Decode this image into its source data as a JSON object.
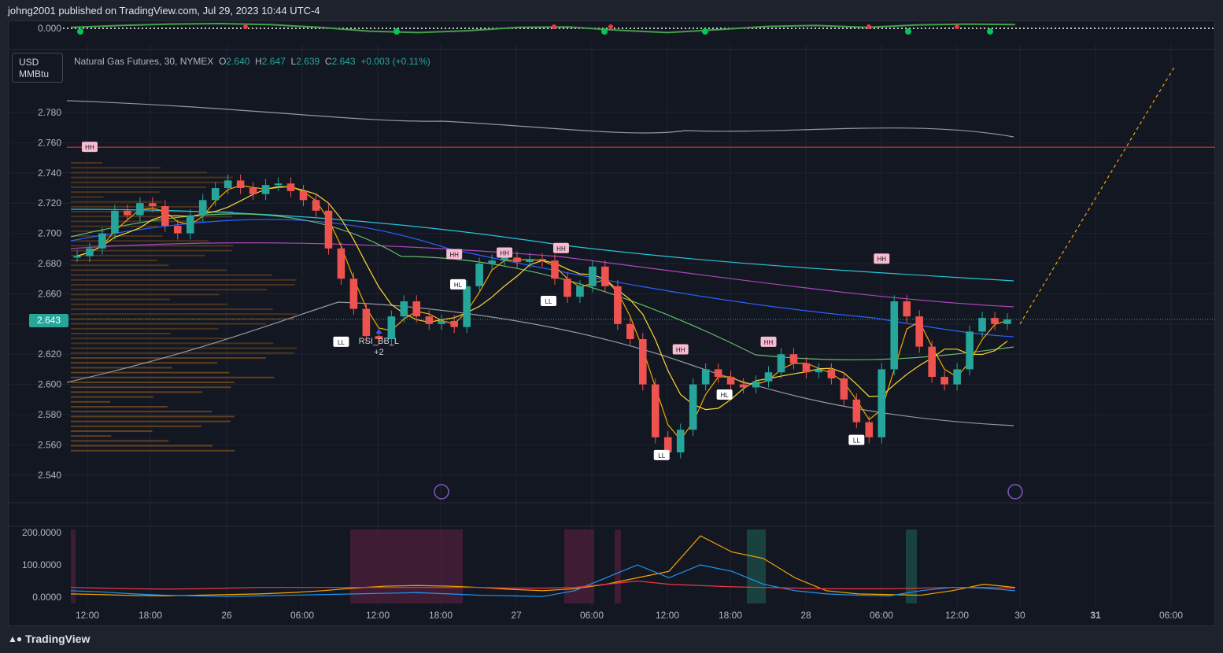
{
  "header": {
    "publish_text": "johng2001 published on TradingView.com, Jul 29, 2023 10:44 UTC-4"
  },
  "unit": {
    "line1": "USD",
    "line2": "MMBtu"
  },
  "legend": {
    "symbol": "Natural Gas Futures, 30, NYMEX",
    "open_label": "O",
    "open": "2.640",
    "high_label": "H",
    "high": "2.647",
    "low_label": "L",
    "low": "2.639",
    "close_label": "C",
    "close": "2.643",
    "change": "+0.003 (+0.11%)"
  },
  "price_tag": "2.643",
  "brand": {
    "name": "TradingView"
  },
  "colors": {
    "up": "#26a69a",
    "down": "#ef5350",
    "accent_tag": "#26a69a",
    "resistance": "#f23645"
  },
  "chart_data": [
    {
      "type": "line",
      "pane": "oscillator",
      "y_tick_labels": [
        "0.000"
      ],
      "series": [
        {
          "name": "",
          "color": "#43a047",
          "values": [
            0.2,
            0.6,
            0.9,
            1.0,
            0.8,
            0.2,
            -0.6,
            -0.9,
            -0.5,
            0.2,
            0.3,
            -0.4,
            -0.9,
            -0.3,
            0.4,
            0.6,
            0.2,
            0.7,
            0.9,
            0.8
          ]
        }
      ],
      "markers_green": 7,
      "markers_red": 6
    },
    {
      "type": "candlestick",
      "pane": "price",
      "title": "Natural Gas Futures, 30, NYMEX",
      "ylim": [
        2.53,
        2.8
      ],
      "y_tick_labels": [
        "2.780",
        "2.760",
        "2.740",
        "2.720",
        "2.700",
        "2.680",
        "2.660",
        "2.640",
        "2.620",
        "2.600",
        "2.580",
        "2.560",
        "2.540"
      ],
      "x_tick_labels": [
        "12:00",
        "18:00",
        "26",
        "06:00",
        "12:00",
        "18:00",
        "27",
        "06:00",
        "12:00",
        "18:00",
        "28",
        "06:00",
        "12:00",
        "30",
        "31",
        "06:00"
      ],
      "x_tick_bold": [
        "26",
        "27",
        "28",
        "30",
        "31"
      ],
      "close": [
        2.685,
        2.69,
        2.7,
        2.715,
        2.712,
        2.72,
        2.718,
        2.705,
        2.7,
        2.712,
        2.722,
        2.73,
        2.735,
        2.73,
        2.726,
        2.732,
        2.733,
        2.728,
        2.722,
        2.715,
        2.69,
        2.67,
        2.65,
        2.632,
        2.63,
        2.645,
        2.655,
        2.645,
        2.64,
        2.642,
        2.638,
        2.665,
        2.68,
        2.682,
        2.684,
        2.681,
        2.683,
        2.682,
        2.67,
        2.658,
        2.665,
        2.678,
        2.665,
        2.64,
        2.63,
        2.6,
        2.565,
        2.555,
        2.57,
        2.6,
        2.61,
        2.605,
        2.6,
        2.598,
        2.602,
        2.608,
        2.62,
        2.614,
        2.608,
        2.61,
        2.604,
        2.59,
        2.575,
        2.565,
        2.61,
        2.655,
        2.645,
        2.625,
        2.605,
        2.6,
        2.61,
        2.635,
        2.644,
        2.64,
        2.643
      ],
      "annotations": [
        {
          "text": "HH",
          "x": 1,
          "price": 2.757
        },
        {
          "text": "LL",
          "x": 21,
          "price": 2.628
        },
        {
          "text": "HH",
          "x": 30,
          "price": 2.686
        },
        {
          "text": "HL",
          "x": 30.3,
          "price": 2.666
        },
        {
          "text": "HH",
          "x": 34,
          "price": 2.687
        },
        {
          "text": "LL",
          "x": 37.5,
          "price": 2.655
        },
        {
          "text": "HH",
          "x": 38.5,
          "price": 2.69
        },
        {
          "text": "LL",
          "x": 46.5,
          "price": 2.553
        },
        {
          "text": "HH",
          "x": 48,
          "price": 2.623
        },
        {
          "text": "HL",
          "x": 51.5,
          "price": 2.593
        },
        {
          "text": "HH",
          "x": 55,
          "price": 2.628
        },
        {
          "text": "LL",
          "x": 62,
          "price": 2.563
        },
        {
          "text": "HH",
          "x": 64,
          "price": 2.683
        }
      ],
      "signal": {
        "text": "RSI_BB_L",
        "count": "+2"
      },
      "resistance_level": 2.757,
      "current_price": 2.643
    },
    {
      "type": "line",
      "pane": "indicator",
      "ylim": [
        0,
        200
      ],
      "y_tick_labels": [
        "200.0000",
        "100.0000",
        "0.0000"
      ],
      "series": [
        {
          "name": "",
          "color": "#f7a600",
          "values": [
            10,
            8,
            5,
            4,
            6,
            8,
            10,
            14,
            20,
            28,
            34,
            36,
            34,
            30,
            24,
            20,
            26,
            40,
            60,
            80,
            190,
            140,
            120,
            60,
            20,
            10,
            8,
            6,
            20,
            40,
            30
          ]
        },
        {
          "name": "",
          "color": "#2196f3",
          "values": [
            20,
            16,
            10,
            6,
            4,
            2,
            4,
            6,
            8,
            10,
            12,
            14,
            10,
            6,
            4,
            2,
            20,
            60,
            100,
            60,
            100,
            80,
            40,
            20,
            10,
            6,
            4,
            20,
            30,
            28,
            20
          ]
        },
        {
          "name": "",
          "color": "#f23645",
          "values": [
            30,
            28,
            26,
            25,
            26,
            28,
            30,
            30,
            30,
            30,
            30,
            30,
            30,
            30,
            28,
            28,
            30,
            40,
            50,
            40,
            36,
            32,
            30,
            28,
            26,
            26,
            26,
            28,
            30,
            30,
            28
          ]
        }
      ]
    }
  ]
}
